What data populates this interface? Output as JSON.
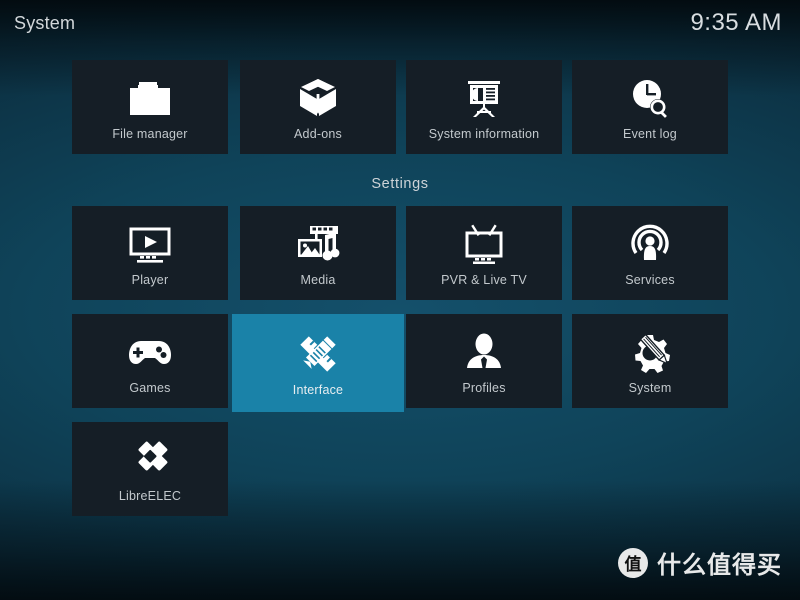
{
  "header": {
    "title": "System",
    "clock": "9:35 AM"
  },
  "colors": {
    "tile_bg": "#151e26",
    "tile_selected_bg": "#1a82a8",
    "label": "#c3c9cd",
    "background_top": "#041219",
    "background_center": "#14506b"
  },
  "section": {
    "settings_label": "Settings"
  },
  "tiles": {
    "top_row": [
      {
        "label": "File manager",
        "icon": "folder-icon",
        "selected": false
      },
      {
        "label": "Add-ons",
        "icon": "open-box-icon",
        "selected": false
      },
      {
        "label": "System information",
        "icon": "presentation-icon",
        "selected": false
      },
      {
        "label": "Event log",
        "icon": "clock-search-icon",
        "selected": false
      }
    ],
    "settings_row_1": [
      {
        "label": "Player",
        "icon": "monitor-play-icon",
        "selected": false
      },
      {
        "label": "Media",
        "icon": "media-library-icon",
        "selected": false
      },
      {
        "label": "PVR & Live TV",
        "icon": "tv-antenna-icon",
        "selected": false
      },
      {
        "label": "Services",
        "icon": "broadcast-icon",
        "selected": false
      }
    ],
    "settings_row_2": [
      {
        "label": "Games",
        "icon": "gamepad-icon",
        "selected": false
      },
      {
        "label": "Interface",
        "icon": "pencil-ruler-icon",
        "selected": true
      },
      {
        "label": "Profiles",
        "icon": "person-icon",
        "selected": false
      },
      {
        "label": "System",
        "icon": "gear-wrench-icon",
        "selected": false
      }
    ],
    "settings_row_3": [
      {
        "label": "LibreELEC",
        "icon": "librelec-diamond-icon",
        "selected": false
      }
    ]
  },
  "watermark": {
    "badge": "值",
    "text": "什么值得买"
  }
}
